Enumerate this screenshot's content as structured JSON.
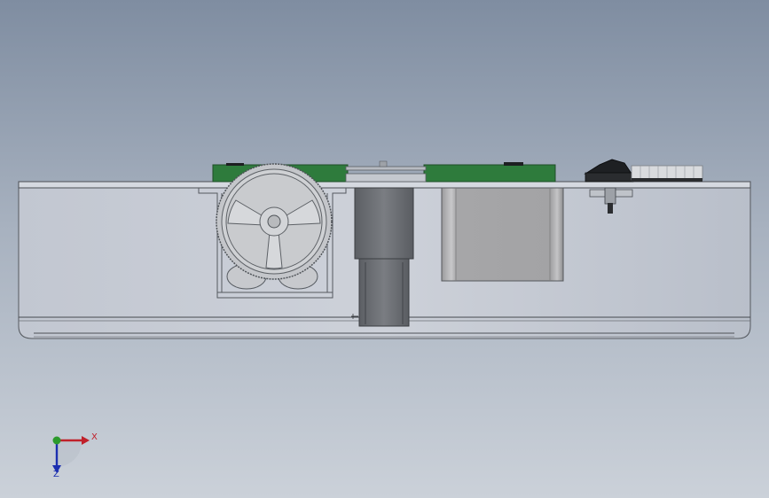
{
  "viewport": {
    "background_top": "#7f8da1",
    "background_bottom": "#cbd1d9"
  },
  "model": {
    "board_color": "#2e7b3c",
    "body_color": "#c9cdd5",
    "part_color": "#a9a9ab",
    "motor_color": "#6b6e73"
  },
  "triad": {
    "x_label": "X",
    "z_label": "Z",
    "x_color": "#c0202a",
    "y_color": "#2c9a2c",
    "z_color": "#1c2fb0"
  }
}
